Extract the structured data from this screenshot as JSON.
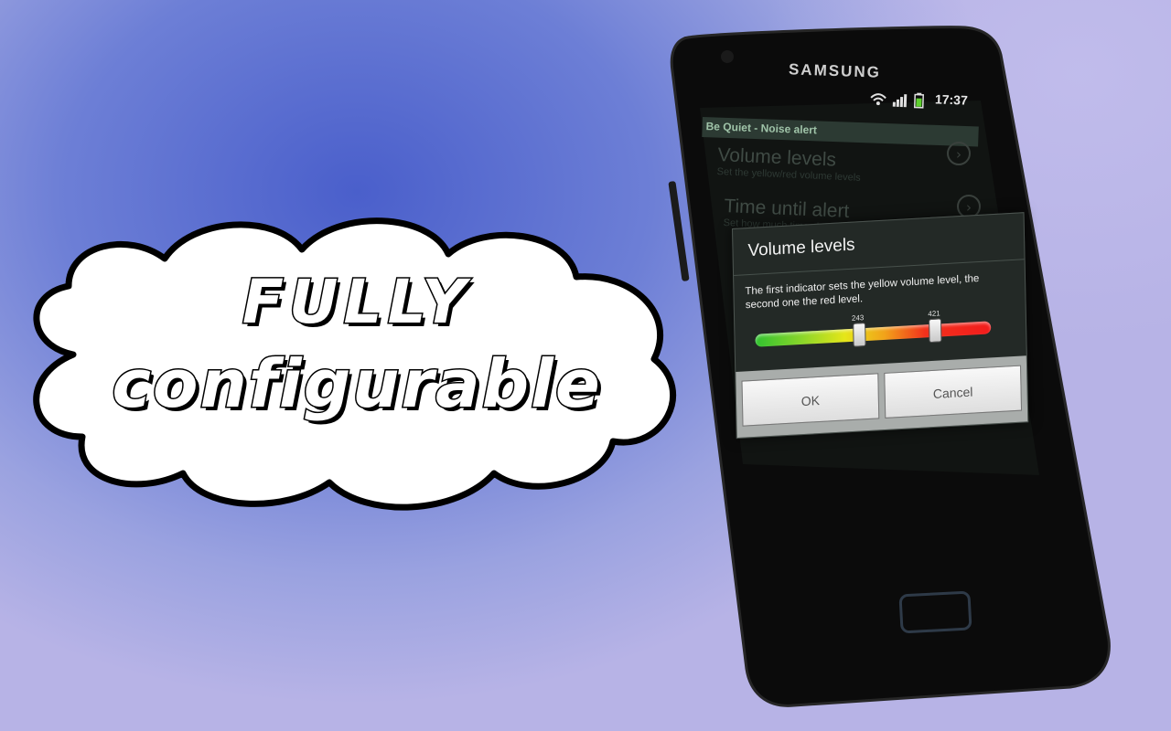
{
  "caption": {
    "line1": "FULLY",
    "line2": "configurable"
  },
  "phone": {
    "brand": "SAMSUNG",
    "status_time": "17:37",
    "status_icons": [
      "wifi-icon",
      "signal-icon",
      "battery-icon"
    ]
  },
  "app": {
    "title": "Be Quiet - Noise alert",
    "items": [
      {
        "title": "Volume levels",
        "subtitle": "Set the yellow/red volume levels"
      },
      {
        "title": "Time until alert",
        "subtitle": "Set how much time should pass until the"
      }
    ]
  },
  "dialog": {
    "title": "Volume levels",
    "message": "The first indicator sets the yellow volume level, the second one the red level.",
    "slider": {
      "yellow_value": "243",
      "red_value": "421",
      "min": 0,
      "max": 550
    },
    "ok_label": "OK",
    "cancel_label": "Cancel"
  },
  "colors": {
    "background": "#5a6ccf",
    "phone_body": "#0c0c0c",
    "dialog_bg": "#232926"
  }
}
